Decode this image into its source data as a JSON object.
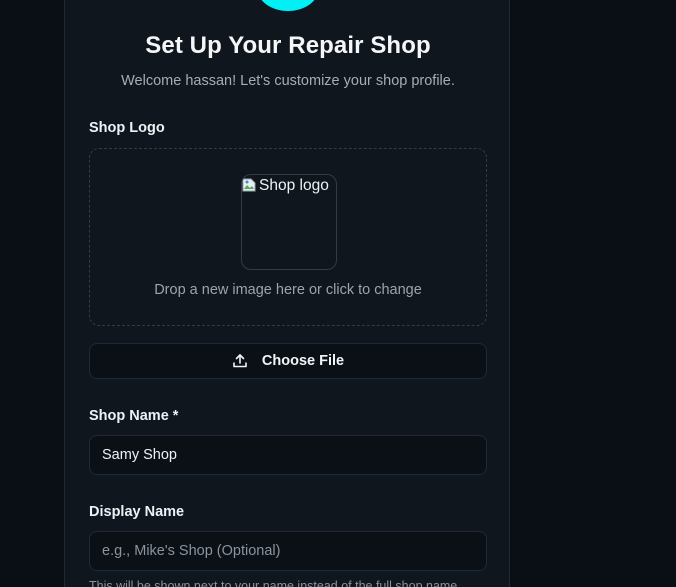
{
  "header": {
    "title": "Set Up Your Repair Shop",
    "subtitle": "Welcome hassan! Let's customize your shop profile."
  },
  "logo_section": {
    "label": "Shop Logo",
    "image_alt": "Shop logo",
    "dropzone_hint": "Drop a new image here or click to change",
    "choose_file_label": "Choose File"
  },
  "shop_name": {
    "label": "Shop Name *",
    "value": "Samy Shop"
  },
  "display_name": {
    "label": "Display Name",
    "value": "",
    "placeholder": "e.g., Mike's Shop (Optional)",
    "help_text": "This will be shown next to your name instead of the full shop name"
  },
  "colors": {
    "accent": "#00f0f5",
    "background": "#0a0f15",
    "card": "#0f161e"
  }
}
